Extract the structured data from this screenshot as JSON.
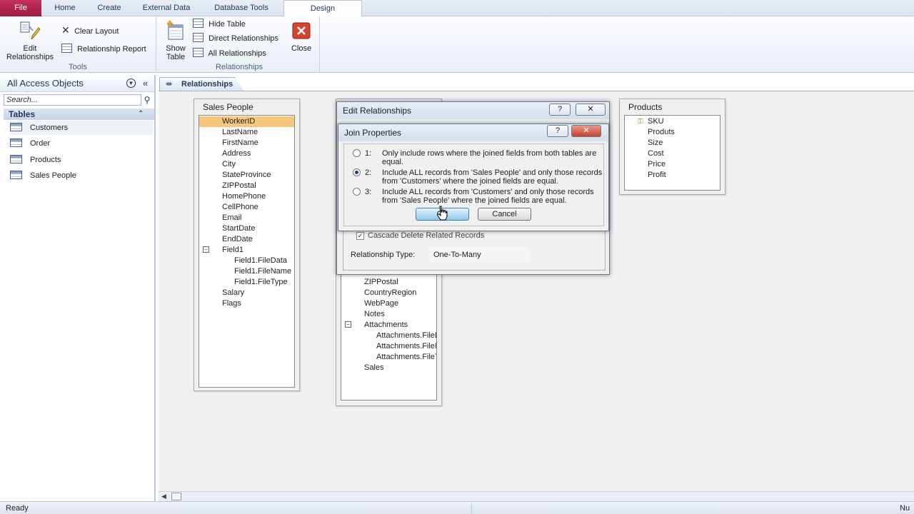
{
  "ribbon": {
    "tabs": [
      "File",
      "Home",
      "Create",
      "External Data",
      "Database Tools",
      "Design"
    ],
    "active_tab": "Design",
    "tools": {
      "label": "Tools",
      "edit_relationships": "Edit Relationships",
      "clear_layout": "Clear Layout",
      "relationship_report": "Relationship Report"
    },
    "relationships": {
      "label": "Relationships",
      "show_table": "Show Table",
      "hide_table": "Hide Table",
      "direct_relationships": "Direct Relationships",
      "all_relationships": "All Relationships",
      "close": "Close"
    }
  },
  "nav": {
    "title": "All Access Objects",
    "search_placeholder": "Search...",
    "group": "Tables",
    "items": [
      "Customers",
      "Order",
      "Products",
      "Sales People"
    ],
    "selected": "Customers"
  },
  "document_tab": "Relationships",
  "tables": {
    "sales_people": {
      "title": "Sales People",
      "fields": [
        "WorkerID",
        "LastName",
        "FirstName",
        "Address",
        "City",
        "StateProvince",
        "ZIPPostal",
        "HomePhone",
        "CellPhone",
        "Email",
        "StartDate",
        "EndDate",
        "Field1",
        "Field1.FileData",
        "Field1.FileName",
        "Field1.FileType",
        "Salary",
        "Flags"
      ]
    },
    "customers_partial": {
      "fields": [
        "ZIPPostal",
        "CountryRegion",
        "WebPage",
        "Notes",
        "Attachments",
        "Attachments.FileData",
        "Attachments.FileName",
        "Attachments.FileType",
        "Sales"
      ]
    },
    "products": {
      "title": "Products",
      "fields": [
        "SKU",
        "Produts",
        "Size",
        "Cost",
        "Price",
        "Profit"
      ]
    }
  },
  "edit_relationships": {
    "title": "Edit Relationships",
    "help": "?",
    "close": "✕",
    "cascade_delete": "Cascade Delete Related Records",
    "relationship_type_label": "Relationship Type:",
    "relationship_type_value": "One-To-Many"
  },
  "join_properties": {
    "title": "Join Properties",
    "help": "?",
    "close": "✕",
    "options": [
      {
        "num": "1:",
        "text": "Only include rows where the joined fields from both tables are equal.",
        "selected": false
      },
      {
        "num": "2:",
        "text": "Include ALL records from 'Sales People' and only those records from 'Customers' where the joined fields are equal.",
        "selected": true
      },
      {
        "num": "3:",
        "text": "Include ALL records from 'Customers' and only those records from 'Sales People' where the joined fields are equal.",
        "selected": false
      }
    ],
    "ok": "OK",
    "cancel": "Cancel"
  },
  "status": {
    "text": "Ready",
    "right": "Nu"
  },
  "colors": {
    "file_tab": "#b5254f",
    "selected_field": "#f7c77e",
    "accent": "#1e395b"
  }
}
